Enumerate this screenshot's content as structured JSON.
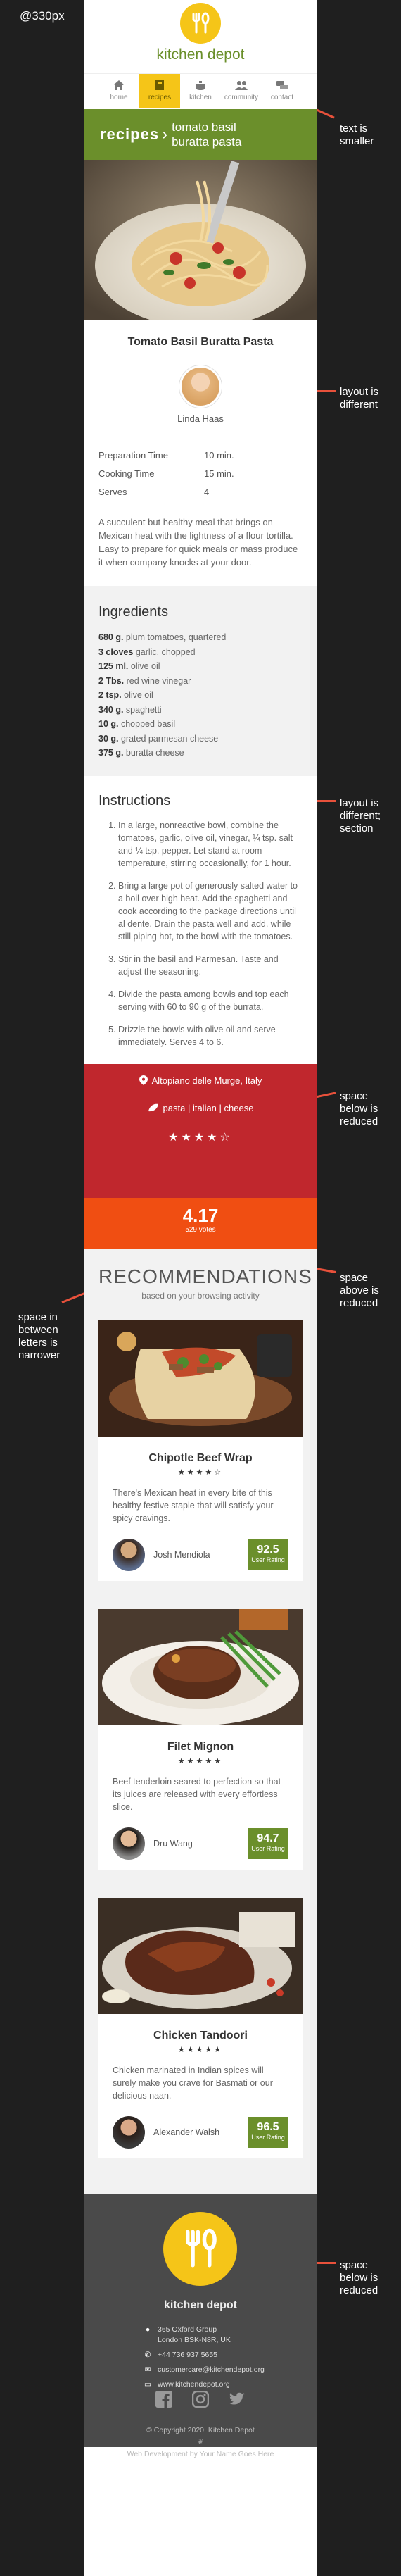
{
  "annotations": {
    "viewport": "@330px",
    "notes": [
      "text is\nsmaller",
      "layout is\ndifferent",
      "layout is\ndifferent;\nsection",
      "space\nbelow is\nreduced",
      "space\nabove is\nreduced",
      "space in\nbetween\nletters is\nnarrower",
      "space\nbelow is\nreduced"
    ]
  },
  "header": {
    "brand": "kitchen depot",
    "nav": [
      {
        "label": "home",
        "icon": "home-icon",
        "active": false
      },
      {
        "label": "recipes",
        "icon": "book-icon",
        "active": true
      },
      {
        "label": "kitchen",
        "icon": "pot-icon",
        "active": false
      },
      {
        "label": "community",
        "icon": "people-icon",
        "active": false
      },
      {
        "label": "contact",
        "icon": "chat-icon",
        "active": false
      }
    ]
  },
  "breadcrumb": {
    "section": "recipes",
    "separator": "›",
    "title_line1": "tomato basil",
    "title_line2": "buratta pasta"
  },
  "recipe": {
    "title": "Tomato Basil Buratta Pasta",
    "author": "Linda Haas",
    "meta": [
      {
        "label": "Preparation Time",
        "value": "10 min."
      },
      {
        "label": "Cooking Time",
        "value": "15 min."
      },
      {
        "label": "Serves",
        "value": "4"
      }
    ],
    "intro": "A succulent but healthy meal that brings on Mexican heat with the lightness of a flour tortilla. Easy to prepare for quick meals or mass produce it when company knocks at your door.",
    "ingredients_heading": "Ingredients",
    "ingredients": [
      {
        "qty": "680 g.",
        "item": " plum tomatoes, quartered"
      },
      {
        "qty": "3 cloves",
        "item": " garlic, chopped"
      },
      {
        "qty": "125 ml.",
        "item": " olive oil"
      },
      {
        "qty": "2 Tbs.",
        "item": " red wine vinegar"
      },
      {
        "qty": "2 tsp.",
        "item": " olive oil"
      },
      {
        "qty": "340 g.",
        "item": " spaghetti"
      },
      {
        "qty": "10 g.",
        "item": " chopped basil"
      },
      {
        "qty": "30 g.",
        "item": " grated parmesan cheese"
      },
      {
        "qty": "375 g.",
        "item": " buratta cheese"
      }
    ],
    "instructions_heading": "Instructions",
    "instructions": [
      "In a large, nonreactive bowl, combine the tomatoes, garlic, olive oil, vinegar, ¼ tsp. salt and ¼ tsp. pepper. Let stand at room temperature, stirring occasionally, for 1 hour.",
      "Bring a large pot of generously salted water to a boil over high heat. Add the spaghetti and cook according to the package directions until al dente. Drain the pasta well and add, while still piping hot, to the bowl with the tomatoes.",
      "Stir in the basil and Parmesan. Taste and adjust the seasoning.",
      "Divide the pasta among bowls and top each serving with 60 to 90 g of the burrata.",
      "Drizzle the bowls with olive oil and serve immediately. Serves 4 to 6."
    ],
    "location": "Altopiano delle Murge, Italy",
    "tags": "pasta | italian | cheese",
    "stars": "★★★★☆",
    "stars_value": 4,
    "score": "4.17",
    "votes": "529 votes"
  },
  "recommendations": {
    "heading": "RECOMMENDATIONS",
    "subheading": "based on your browsing activity",
    "cards": [
      {
        "title": "Chipotle Beef Wrap",
        "stars": "★★★★☆",
        "desc": "There's Mexican heat in every bite of this healthy festive staple that will satisfy your spicy cravings.",
        "author": "Josh Mendiola",
        "rating": "92.5",
        "rating_label": "User Rating"
      },
      {
        "title": "Filet Mignon",
        "stars": "★★★★★",
        "desc": "Beef tenderloin seared to perfection so that its juices are released with every effortless slice.",
        "author": "Dru Wang",
        "rating": "94.7",
        "rating_label": "User Rating"
      },
      {
        "title": "Chicken Tandoori",
        "stars": "★★★★★",
        "desc": "Chicken marinated in Indian spices will surely make you crave for Basmati or our delicious naan.",
        "author": "Alexander Walsh",
        "rating": "96.5",
        "rating_label": "User Rating"
      }
    ]
  },
  "footer": {
    "brand": "kitchen depot",
    "address_line1": "365 Oxford Group",
    "address_line2": "London BSK-N8R, UK",
    "phone": "+44 736 937 5655",
    "email": "customercare@kitchendepot.org",
    "website": "www.kitchendepot.org",
    "copyright": "© Copyright 2020, Kitchen Depot",
    "credit": "Web Development by Your Name Goes Here"
  },
  "colors": {
    "green": "#6b8f2b",
    "yellow": "#f5c518",
    "red": "#c0272d",
    "orange": "#f04e12",
    "footer": "#4a4a4a",
    "annotation": "#e8513b"
  }
}
